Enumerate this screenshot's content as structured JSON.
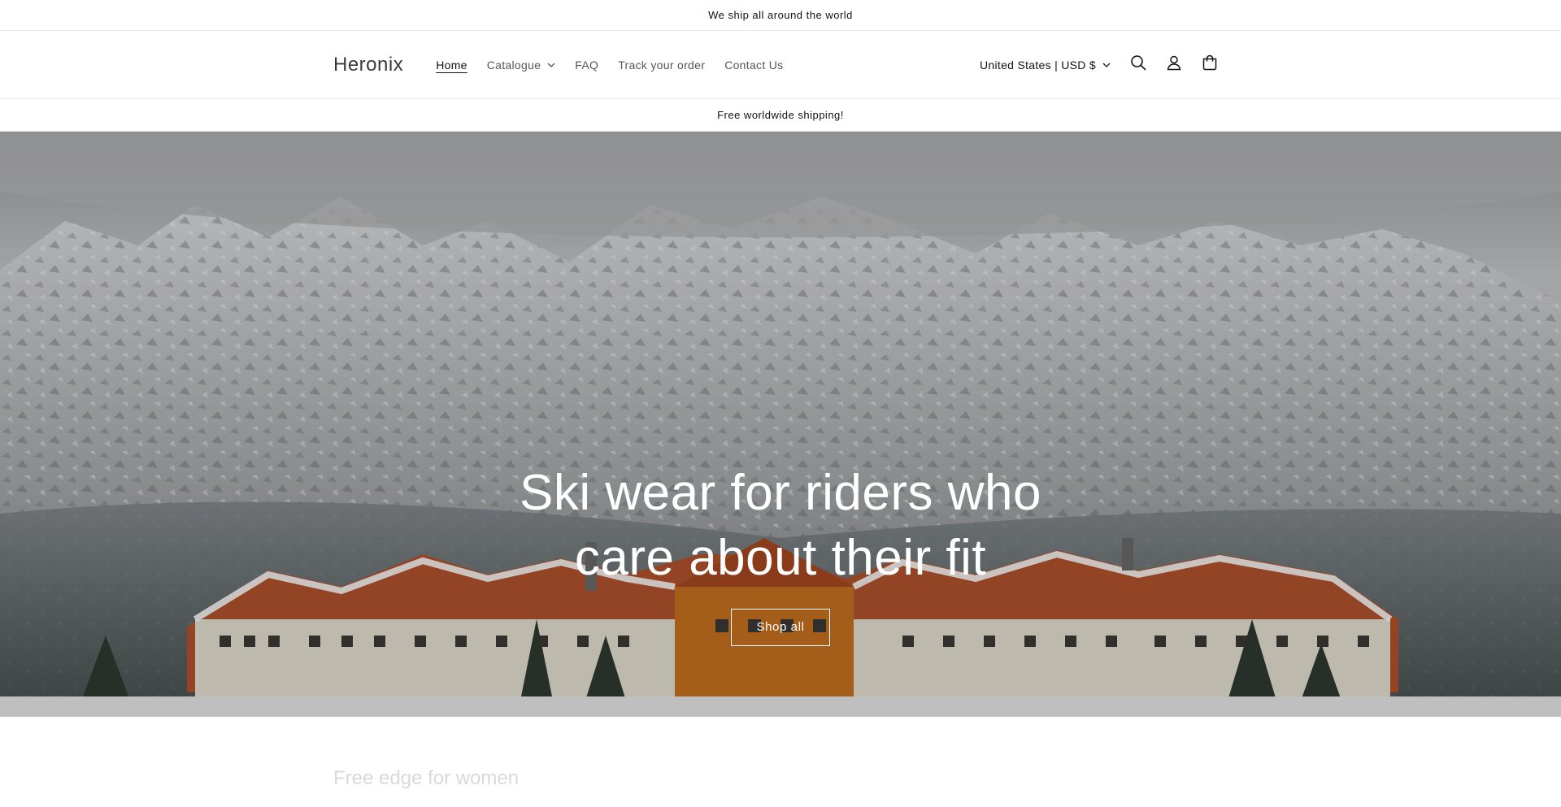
{
  "announcement": {
    "text": "We ship all around the world"
  },
  "header": {
    "logo": "Heronix",
    "nav": [
      {
        "label": "Home",
        "active": true
      },
      {
        "label": "Catalogue",
        "dropdown": true
      },
      {
        "label": "FAQ"
      },
      {
        "label": "Track your order"
      },
      {
        "label": "Contact Us"
      }
    ],
    "currency": "United States | USD $",
    "icons": [
      "search-icon",
      "account-icon",
      "cart-icon"
    ]
  },
  "sub_announcement": {
    "text": "Free worldwide shipping!"
  },
  "hero": {
    "title": "Ski wear for riders who care about their fit",
    "button_label": "Shop all"
  },
  "next_section": {
    "heading": "Free edge for women"
  },
  "colors": {
    "text": "#121212",
    "muted": "#555555",
    "border": "#e6e6e6",
    "hero_text": "#ffffff"
  }
}
